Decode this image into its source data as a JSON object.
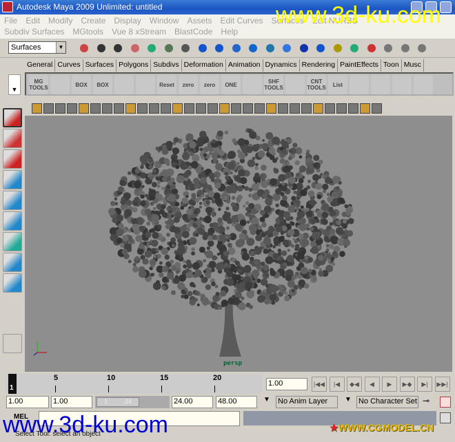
{
  "title": "Autodesk Maya 2009 Unlimited: untitled",
  "menus_row1": [
    "File",
    "Edit",
    "Modify",
    "Create",
    "Display",
    "Window",
    "Assets",
    "Edit Curves",
    "Surfaces",
    "Edit NURBS"
  ],
  "menus_row2": [
    "Subdiv Surfaces",
    "MGtools",
    "Vue 8 xStream",
    "BlastCode",
    "Help"
  ],
  "status_line": {
    "mode": "Surfaces"
  },
  "shelf_tabs": [
    "General",
    "Curves",
    "Surfaces",
    "Polygons",
    "Subdivs",
    "Deformation",
    "Animation",
    "Dynamics",
    "Rendering",
    "PaintEffects",
    "Toon",
    "Musc"
  ],
  "shelf_buttons": [
    "MG TOOLS",
    "",
    "BOX",
    "BOX",
    "",
    "",
    "Reset",
    "zero",
    "zero",
    "ONE",
    "",
    "SHF TOOLS",
    "",
    "CNT TOOLS",
    "List",
    "",
    "",
    "",
    ""
  ],
  "viewport": {
    "camera": "persp",
    "background": "#8e8e8e"
  },
  "time_slider": {
    "ticks": [
      "5",
      "10",
      "15",
      "20"
    ],
    "current_frame": "1",
    "current_time": "1.00"
  },
  "range": {
    "start": "1.00",
    "playback_start": "1.00",
    "slider_start": "1",
    "slider_end": "24",
    "playback_end": "24.00",
    "end": "48.00",
    "anim_layer": "No Anim Layer",
    "character_set": "No Character Set"
  },
  "command_line": {
    "label": "MEL",
    "value": ""
  },
  "help_line": "Select Tool: select an object",
  "watermarks": {
    "top": "www.3d-ku.com",
    "bottom": "www.3d-ku.com",
    "logo": "WWW.CGMODEL.CN"
  }
}
